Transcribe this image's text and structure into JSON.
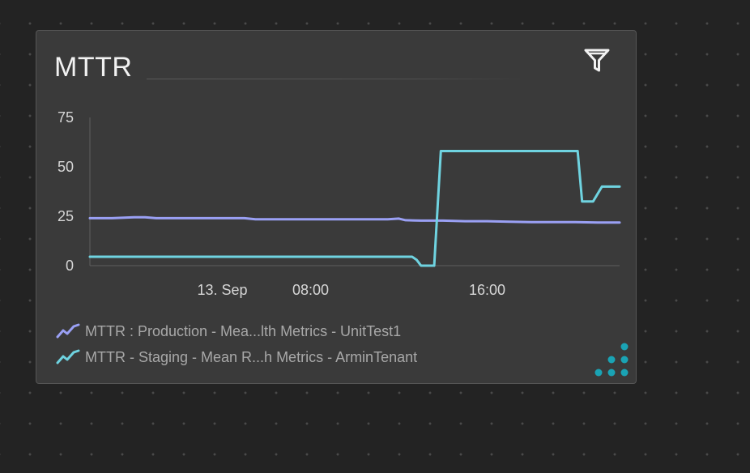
{
  "tile": {
    "title": "MTTR",
    "icons": {
      "filter": "filter-icon",
      "resize": "resize-handle-icon"
    }
  },
  "chart_data": {
    "type": "line",
    "title": "MTTR",
    "xlabel": "",
    "ylabel": "",
    "ylim": [
      0,
      75
    ],
    "yticks": [
      "0",
      "25",
      "50",
      "75"
    ],
    "xticks": [
      {
        "label": "13. Sep",
        "hour": 4
      },
      {
        "label": "08:00",
        "hour": 8
      },
      {
        "label": "16:00",
        "hour": 16
      }
    ],
    "xlim_hours": [
      -2,
      22
    ],
    "grid": false,
    "legend_position": "bottom-left",
    "series": [
      {
        "name": "MTTR : Production - Mea...lth Metrics - UnitTest1",
        "color": "#9aa0f4",
        "points": [
          [
            -2,
            24
          ],
          [
            -1,
            24
          ],
          [
            0,
            24.5
          ],
          [
            0.5,
            24.5
          ],
          [
            1,
            24
          ],
          [
            3,
            24
          ],
          [
            5,
            24
          ],
          [
            5.5,
            23.5
          ],
          [
            8,
            23.5
          ],
          [
            10,
            23.5
          ],
          [
            11.5,
            23.5
          ],
          [
            12,
            23.8
          ],
          [
            12.3,
            23
          ],
          [
            13,
            22.8
          ],
          [
            14,
            22.8
          ],
          [
            15,
            22.5
          ],
          [
            16,
            22.5
          ],
          [
            17,
            22.2
          ],
          [
            18,
            22
          ],
          [
            19,
            22
          ],
          [
            20,
            22
          ],
          [
            21,
            21.8
          ],
          [
            22,
            21.8
          ]
        ]
      },
      {
        "name": "MTTR - Staging - Mean R...h Metrics - ArminTenant",
        "color": "#6fd3e0",
        "points": [
          [
            -2,
            4.5
          ],
          [
            4,
            4.5
          ],
          [
            8,
            4.5
          ],
          [
            12,
            4.5
          ],
          [
            12.6,
            4.5
          ],
          [
            12.8,
            3
          ],
          [
            13,
            0
          ],
          [
            13.6,
            0
          ],
          [
            13.9,
            58
          ],
          [
            16,
            58
          ],
          [
            18,
            58
          ],
          [
            20.1,
            58
          ],
          [
            20.3,
            32.5
          ],
          [
            20.6,
            32.5
          ],
          [
            20.8,
            32.5
          ],
          [
            21.2,
            40
          ],
          [
            22,
            40
          ]
        ]
      }
    ]
  }
}
